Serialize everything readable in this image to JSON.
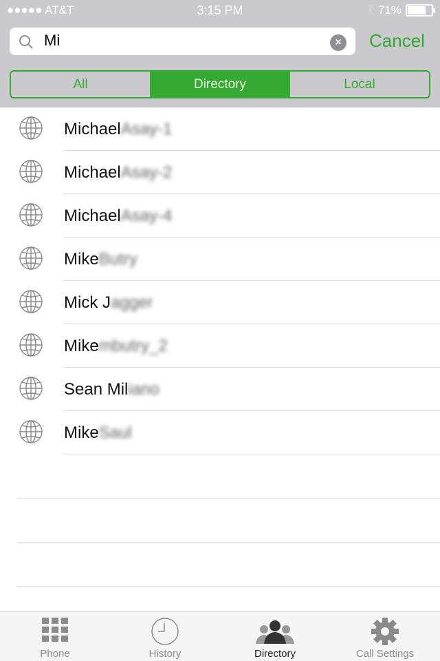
{
  "status": {
    "carrier": "●●●●● AT&T",
    "time": "3:15 PM",
    "battery": "71%",
    "battery_level": 0.71
  },
  "search": {
    "value": "Mi",
    "cancel": "Cancel"
  },
  "segments": [
    {
      "label": "All"
    },
    {
      "label": "Directory",
      "selected": true
    },
    {
      "label": "Local"
    }
  ],
  "results": [
    {
      "name": "Michael",
      "blurred": "Asay-1"
    },
    {
      "name": "Michael",
      "blurred": "Asay-2"
    },
    {
      "name": "Michael",
      "blurred": "Asay-4"
    },
    {
      "name": "Mike",
      "blurred": "Butry"
    },
    {
      "name": "Mick J",
      "blurred": "agger"
    },
    {
      "name": "Mike",
      "blurred": "mbutry_2"
    },
    {
      "name": "Sean Mil",
      "blurred": "iano"
    },
    {
      "name": "Mike",
      "blurred": "Saul"
    }
  ],
  "tabs": [
    {
      "label": "Phone",
      "icon": "keypad-icon"
    },
    {
      "label": "History",
      "icon": "clock-icon"
    },
    {
      "label": "Directory",
      "icon": "people-icon",
      "selected": true
    },
    {
      "label": "Call Settings",
      "icon": "gear-icon"
    }
  ],
  "colors": {
    "accent": "#35a931"
  }
}
